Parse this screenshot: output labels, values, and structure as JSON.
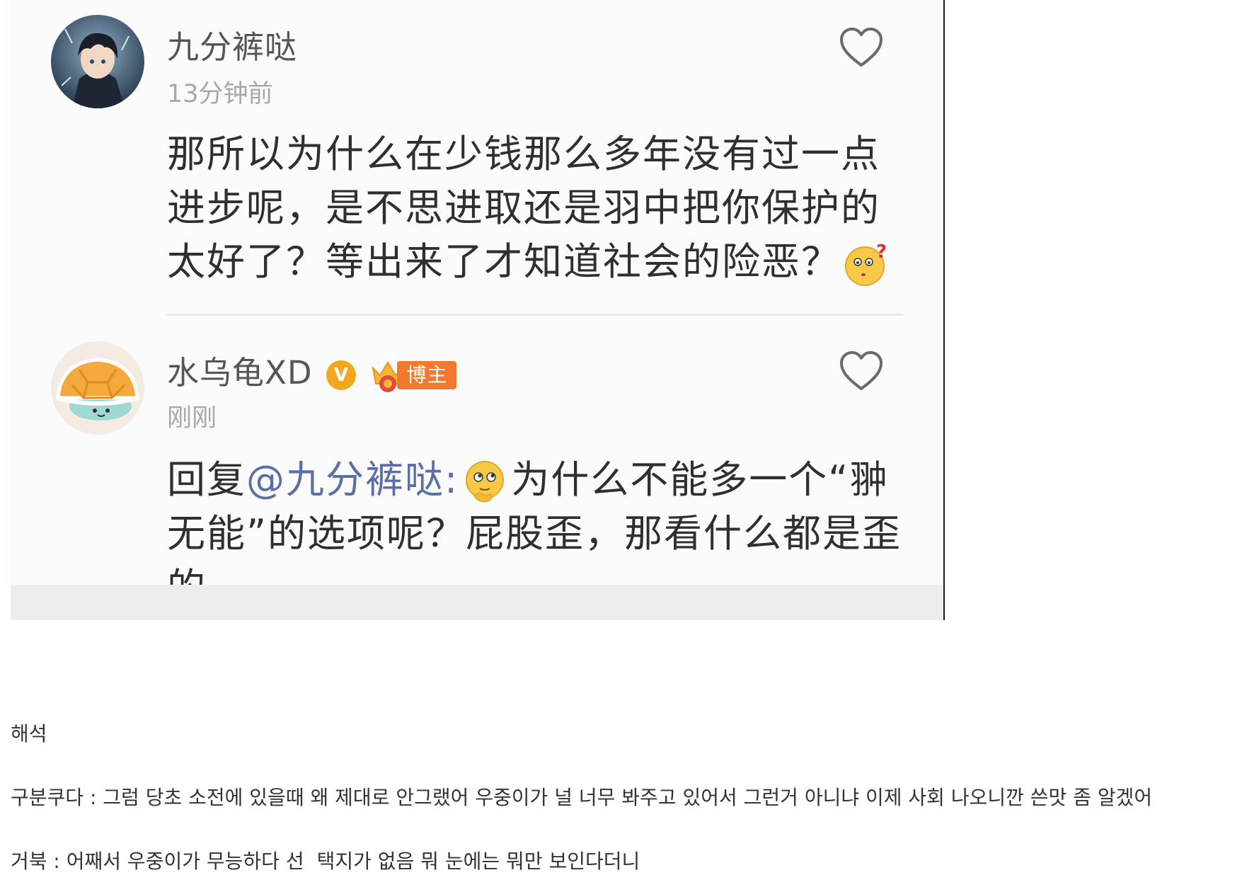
{
  "comments": [
    {
      "username": "九分裤哒",
      "timestamp": "13分钟前",
      "body": "那所以为什么在少钱那么多年没有过一点进步呢，是不思进取还是羽中把你保护的太好了？等出来了才知道社会的险恶？",
      "emoji": "question-face-emoji"
    },
    {
      "username": "水乌龟XD",
      "verified_badge": "V",
      "blogger_badge": "博主",
      "timestamp": "刚刚",
      "reply_prefix": "回复",
      "mention": "@九分裤哒",
      "mention_suffix": ":",
      "emoji": "thinking-face-emoji",
      "body": "为什么不能多一个“翀无能”的选项呢？屁股歪，那看什么都是歪的"
    }
  ],
  "post": {
    "heading": "해석",
    "line_1": "구분쿠다 : 그럼 당초 소전에 있을때 왜 제대로 안그랬어 우중이가 널 너무 봐주고 있어서 그런거 아니냐 이제 사회 나오니깐 쓴맛 좀 알겠어",
    "line_2_a": "거북 : 어째서 우중이가 무능하다 선",
    "line_2_b": "택지가 없음 뭐 눈에는 뭐만 보인다더니"
  },
  "colors": {
    "mention": "#5a6fa6",
    "verified": "#f2a81d",
    "blogger": "#f2792f",
    "background": "#fbfbfb"
  }
}
